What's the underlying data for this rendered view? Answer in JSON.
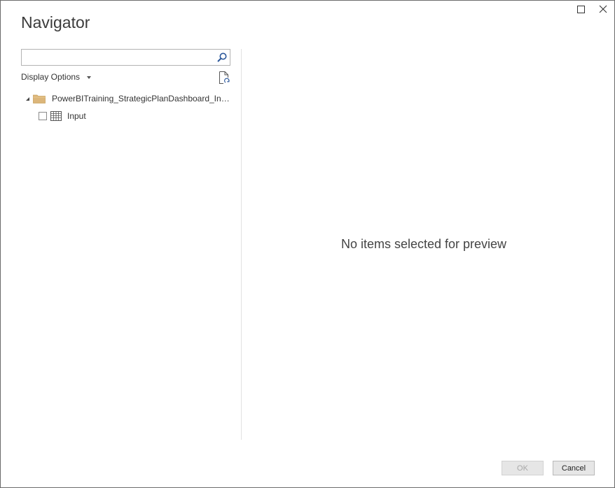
{
  "window": {
    "title": "Navigator"
  },
  "search": {
    "placeholder": "",
    "value": ""
  },
  "display_options": {
    "label": "Display Options"
  },
  "tree": {
    "folder": {
      "label": "PowerBITraining_StrategicPlanDashboard_Input.xlsx",
      "expanded": true
    },
    "items": [
      {
        "label": "Input",
        "checked": false
      }
    ]
  },
  "preview": {
    "message": "No items selected for preview"
  },
  "buttons": {
    "ok": "OK",
    "cancel": "Cancel"
  },
  "colors": {
    "folder": "#dcb67a",
    "accent": "#2b579a"
  }
}
